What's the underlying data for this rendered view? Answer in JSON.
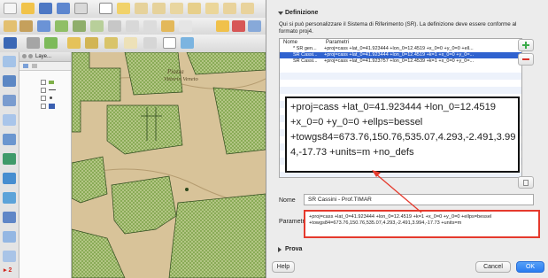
{
  "layers_panel": {
    "title": "Laye..."
  },
  "map": {
    "label_line1": "Piazza",
    "label_line2": "Vittorio Veneto"
  },
  "section": {
    "title": "Definizione",
    "prova_title": "Prova"
  },
  "description": "Qui si può personalizzare il Sistema di Riferimento (SR). La definizione deve essere conforme al formato proj4.",
  "table": {
    "headers": {
      "name": "Nome",
      "params": "Parametri"
    },
    "rows": [
      {
        "name": "* SR gen...",
        "params": "+proj=cass +lat_0=41.923444 +lon_0=12.4519 +x_0=0 +y_0=0 +ell...",
        "selected": false
      },
      {
        "name": "SR Cassi...",
        "params": "+proj=cass +lat_0=41.923444 +lon_0=12.4519 +k=1 +x_0=0 +y_0=...",
        "selected": true
      },
      {
        "name": "SR Cassi...",
        "params": "+proj=cass +lat_0=41.923757 +lon_0=12.4539 +k=1 +x_0=0 +y_0=...",
        "selected": false
      }
    ]
  },
  "zoom_callout": {
    "lines": [
      "+proj=cass +lat_0=41.923444 +lon_0=12.4519",
      "+x_0=0 +y_0=0 +ellps=bessel",
      "+towgs84=673.76,150.76,535.07,4.293,-2.491,3.99",
      "4,-17.73 +units=m +no_defs"
    ]
  },
  "form": {
    "name_label": "Nome",
    "name_value": "SR Cassini - Prof.TIMAR",
    "params_label": "Parametri",
    "params_value": "+proj=cass +lat_0=41.923444 +lon_0=12.4519 +k=1 +x_0=0 +y_0=0 +ellps=bessel +towgs84=673.76,150.76,535.07,4.293,-2.491,3.994,-17.73 +units=m"
  },
  "buttons": {
    "help": "Help",
    "cancel": "Cancel",
    "ok": "OK"
  },
  "badge": "▸ 2",
  "colors": {
    "selection": "#2f62cf",
    "highlight": "#e53a2d",
    "ok_button": "#2b7cf0",
    "add_icon": "#3bab4a",
    "remove_icon": "#d8322a"
  },
  "icons": [
    "add-crs-icon",
    "remove-crs-icon",
    "copy-icon",
    "expand-triangle-icon",
    "collapse-triangle-icon"
  ]
}
